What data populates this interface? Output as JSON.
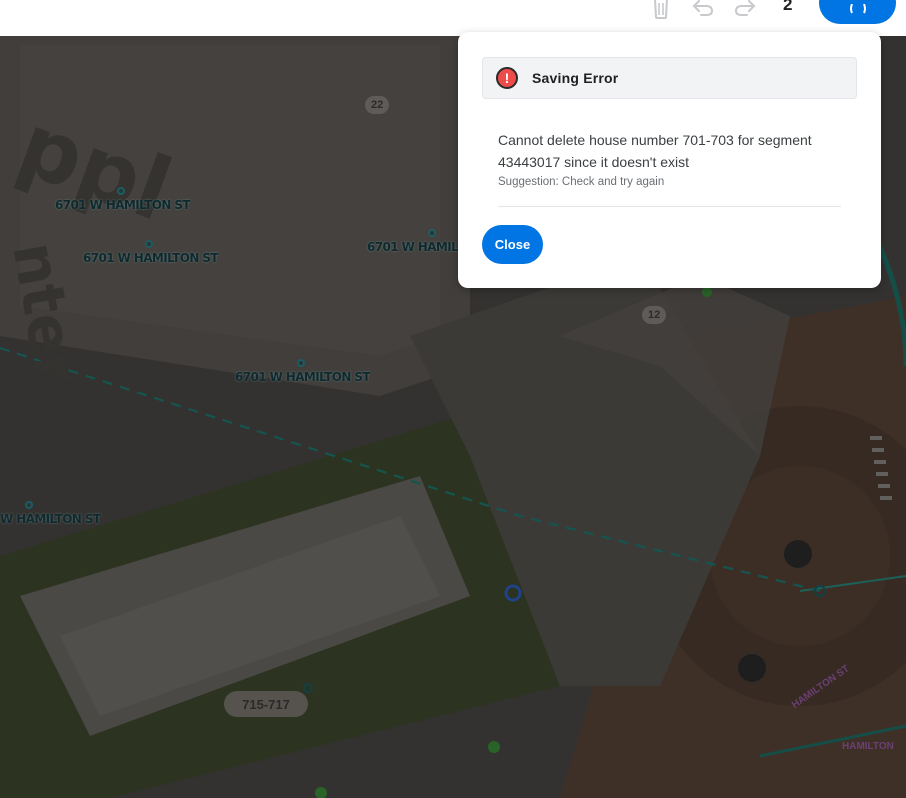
{
  "toolbar": {
    "icons": {
      "trash": "trash-icon",
      "undo": "undo-icon",
      "redo": "redo-icon"
    },
    "pending_count": "2",
    "save_icon": "save-icon"
  },
  "map": {
    "segment_numbers": [
      "22",
      "12"
    ],
    "address_labels": [
      "6701 W HAMILTON ST",
      "6701 W HAMILTON ST",
      "6701 W HAMIL",
      "6701 W HAMILTON ST",
      "W HAMILTON ST"
    ],
    "house_number": "715-717",
    "road_labels": [
      "HAMILTON ST",
      "HAMILTON"
    ],
    "watermark_text": [
      "ppl",
      "nter"
    ]
  },
  "dialog": {
    "title": "Saving Error",
    "icon": "error-icon",
    "message": "Cannot delete house number 701-703 for segment 43443017 since it doesn't exist",
    "suggestion": "Suggestion: Check and try again",
    "close_label": "Close"
  },
  "colors": {
    "accent": "#0075e3",
    "error": "#ee4b4b",
    "dialog_bg": "#ffffff",
    "header_bg": "#f2f3f5"
  }
}
